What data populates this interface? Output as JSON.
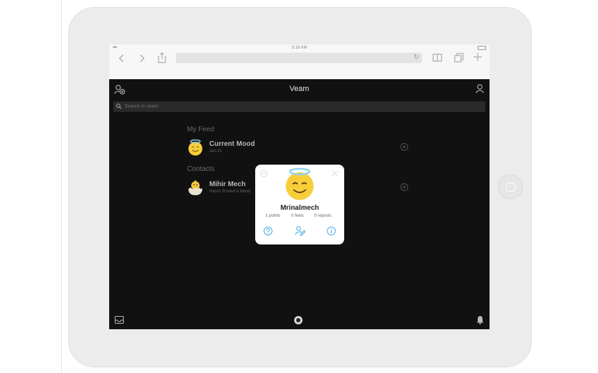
{
  "device": {
    "frame_color": "#ececec",
    "screen_bg": "#111111"
  },
  "browser": {
    "time": "3:18 AM",
    "signal": "•••••",
    "url": "",
    "icons": [
      "chevron-left-icon",
      "chevron-right-icon",
      "share-icon",
      "reload-icon",
      "book-icon",
      "tabs-icon",
      "plus-icon"
    ]
  },
  "app": {
    "title": "Veam",
    "search_placeholder": "Search in veam",
    "sections": {
      "feed": "My Feed",
      "contacts": "Contacts"
    },
    "feed": [
      {
        "name": "Current Mood",
        "sub": "Jan 21"
      }
    ],
    "contacts": [
      {
        "name": "Mihir Mech",
        "sub": "Hasn't Posted A Mood"
      }
    ]
  },
  "popup": {
    "username": "Mrinalmech",
    "points": "1 points",
    "feels": "0 feels",
    "reposts": "0 reposts"
  },
  "colors": {
    "accent": "#3ea9e2",
    "halo": "#8fd4f0",
    "emoji": "#f7cd3a"
  }
}
